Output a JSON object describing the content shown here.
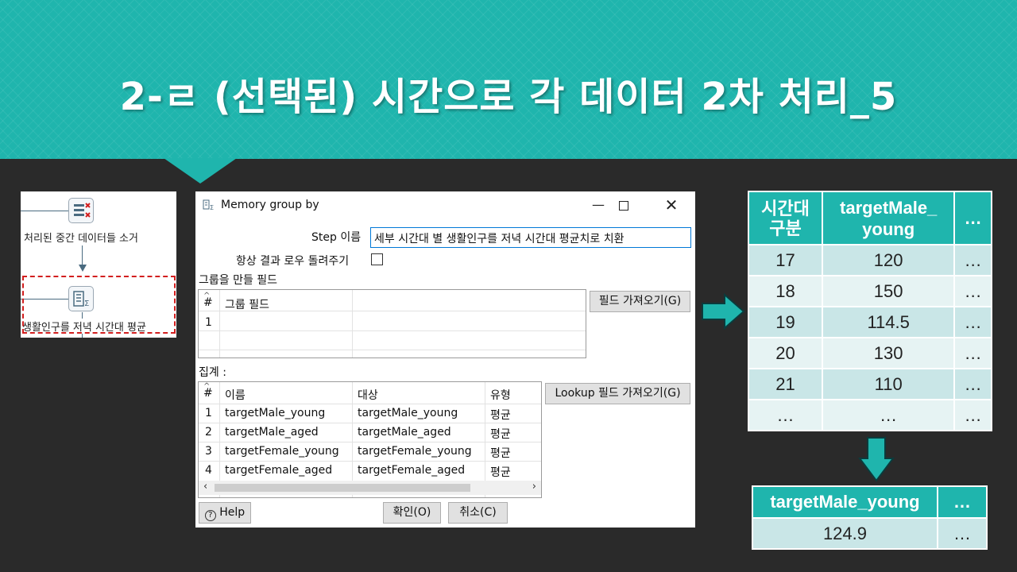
{
  "slide": {
    "title": "2-ㄹ (선택된) 시간으로 각 데이터 2차 처리_5"
  },
  "flow": {
    "step1_label": "처리된 중간 데이터들 소거",
    "step2_label": "생활인구를 저녁 시간대 평균"
  },
  "dialog": {
    "title": "Memory group by",
    "step_name_label": "Step 이름",
    "step_name_value": "세부 시간대 별 생활인구를 저녁 시간대 평균치로 치환",
    "always_return_label": "항상 결과 로우 돌려주기",
    "group_fields_label": "그룹을 만들 필드",
    "group_grid": {
      "col_hash": "#",
      "col_field": "그룹 필드",
      "rows": [
        "1"
      ]
    },
    "get_fields_button": "필드 가져오기(G)",
    "aggregate_label": "집계 :",
    "agg_grid": {
      "col_hash": "#",
      "col_name": "이름",
      "col_subject": "대상",
      "col_type": "유형",
      "rows": [
        {
          "n": "1",
          "name": "targetMale_young",
          "subject": "targetMale_young",
          "type": "평균"
        },
        {
          "n": "2",
          "name": "targetMale_aged",
          "subject": "targetMale_aged",
          "type": "평균"
        },
        {
          "n": "3",
          "name": "targetFemale_young",
          "subject": "targetFemale_young",
          "type": "평균"
        },
        {
          "n": "4",
          "name": "targetFemale_aged",
          "subject": "targetFemale_aged",
          "type": "평균"
        }
      ]
    },
    "lookup_button": "Lookup 필드 가져오기(G)",
    "help_button": "Help",
    "ok_button": "확인(O)",
    "cancel_button": "취소(C)"
  },
  "table_right": {
    "headers": [
      "시간대\n구분",
      "targetMale_\nyoung",
      "…"
    ],
    "rows": [
      [
        "17",
        "120",
        "…"
      ],
      [
        "18",
        "150",
        "…"
      ],
      [
        "19",
        "114.5",
        "…"
      ],
      [
        "20",
        "130",
        "…"
      ],
      [
        "21",
        "110",
        "…"
      ],
      [
        "…",
        "…",
        "…"
      ]
    ]
  },
  "table_result": {
    "headers": [
      "targetMale_young",
      "…"
    ],
    "rows": [
      [
        "124.9",
        "…"
      ]
    ]
  },
  "colors": {
    "accent": "#1fb5ad",
    "row_odd": "#c9e6e7",
    "row_even": "#e6f3f3",
    "selection": "#d21f1f"
  }
}
